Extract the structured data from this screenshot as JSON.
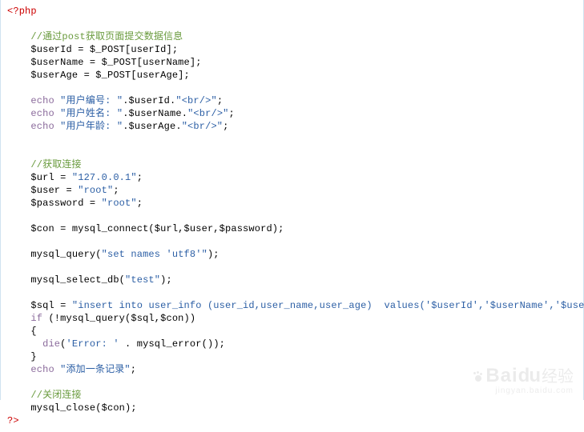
{
  "code": {
    "open_tag": "<?php",
    "close_tag": "?>",
    "c1": "//通过post获取页面提交数据信息",
    "l1a": "$userId = $_POST[userId];",
    "l1b": "$userName = $_POST[userName];",
    "l1c": "$userAge = $_POST[userAge];",
    "echo_kw": "echo",
    "e1_s": "\"用户编号: \"",
    "e1_mid": ".$userId.",
    "e1_br": "\"<br/>\"",
    "e2_s": "\"用户姓名: \"",
    "e2_mid": ".$userName.",
    "e3_s": "\"用户年龄: \"",
    "e3_mid": ".$userAge.",
    "semicolon": ";",
    "c2": "//获取连接",
    "l2a_pre": "$url = ",
    "l2a_str": "\"127.0.0.1\"",
    "l2b_pre": "$user = ",
    "l2b_str": "\"root\"",
    "l2c_pre": "$password = ",
    "l2c_str": "\"root\"",
    "l3": "$con = mysql_connect($url,$user,$password);",
    "l4_pre": "mysql_query(",
    "l4_str": "\"set names 'utf8'\"",
    "l4_post": ");",
    "l5_pre": "mysql_select_db(",
    "l5_str": "\"test\"",
    "l5_post": ");",
    "l6_pre": "$sql = ",
    "l6_str": "\"insert into user_info (user_id,user_name,user_age)  values('$userId','$userName','$userAge')\"",
    "if_kw": "if",
    "l7_cond": " (!mysql_query($sql,$con))",
    "brace_o": "{",
    "brace_c": "}",
    "die_kw": "die",
    "l8_pre": "(",
    "l8_str": "'Error: '",
    "l8_post": " . mysql_error());",
    "e4_str": "\"添加一条记录\"",
    "c3": "//关闭连接",
    "l9": "mysql_close($con);",
    "indent1": "    ",
    "indent2": "      "
  },
  "watermark": {
    "brand_en": "Bai",
    "brand_du": "du",
    "brand_cn": "经验",
    "sub": "jingyan.baidu.com"
  }
}
